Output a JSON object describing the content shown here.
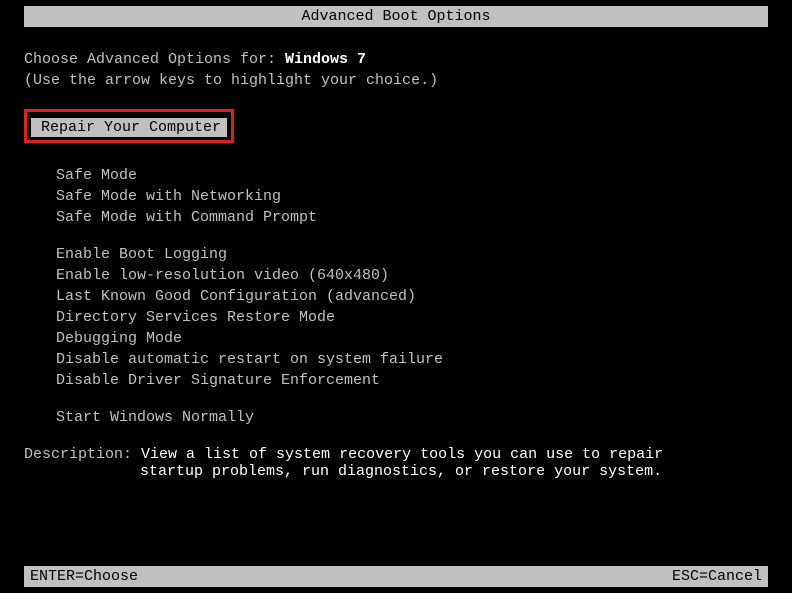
{
  "title": "Advanced Boot Options",
  "prompt_prefix": "Choose Advanced Options for: ",
  "os_name": "Windows 7",
  "hint": "(Use the arrow keys to highlight your choice.)",
  "selected_item": "Repair Your Computer",
  "group1": {
    "item0": "Safe Mode",
    "item1": "Safe Mode with Networking",
    "item2": "Safe Mode with Command Prompt"
  },
  "group2": {
    "item0": "Enable Boot Logging",
    "item1": "Enable low-resolution video (640x480)",
    "item2": "Last Known Good Configuration (advanced)",
    "item3": "Directory Services Restore Mode",
    "item4": "Debugging Mode",
    "item5": "Disable automatic restart on system failure",
    "item6": "Disable Driver Signature Enforcement"
  },
  "group3": {
    "item0": "Start Windows Normally"
  },
  "description": {
    "label": "Description: ",
    "line1": "View a list of system recovery tools you can use to repair",
    "line2": "startup problems, run diagnostics, or restore your system."
  },
  "footer": {
    "left": "ENTER=Choose",
    "right": "ESC=Cancel"
  }
}
